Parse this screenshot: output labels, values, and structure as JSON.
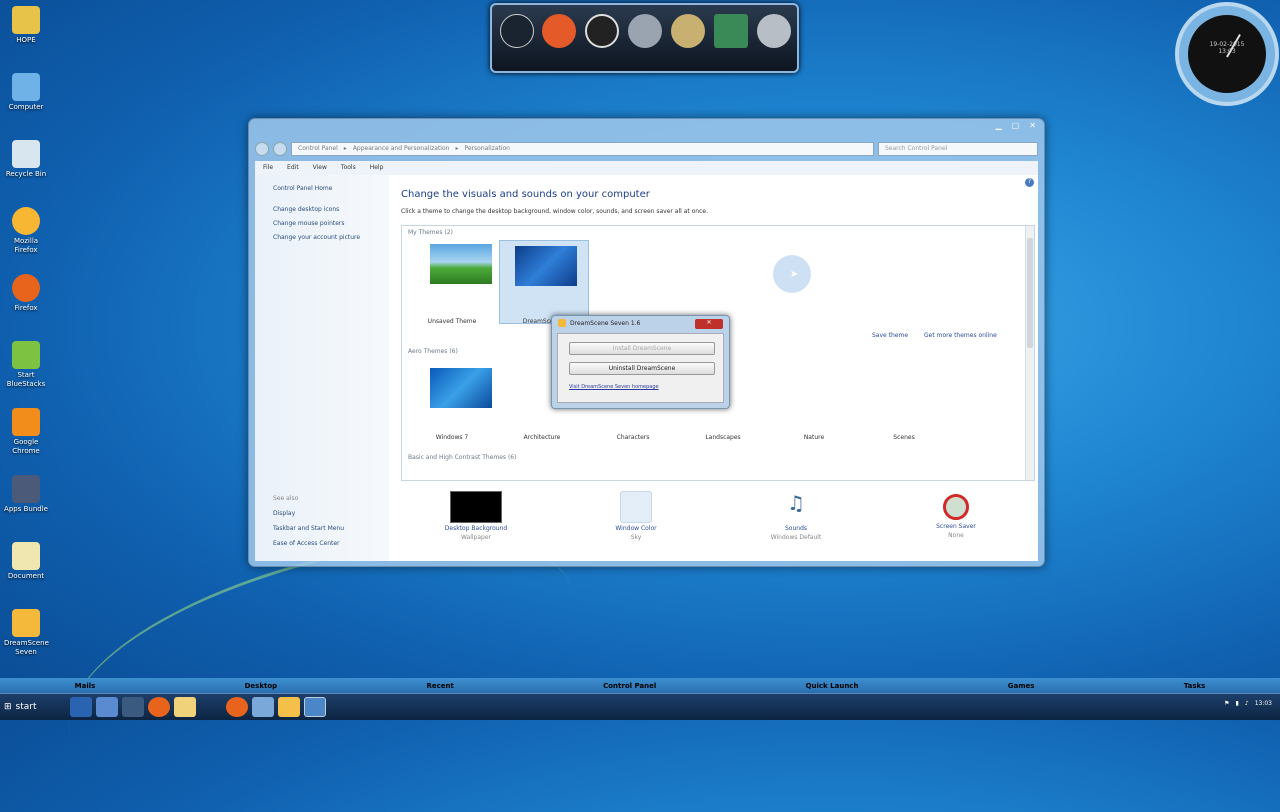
{
  "desktop": {
    "icons": [
      {
        "label": "HOPE",
        "color": "#e8c34a"
      },
      {
        "label": "Computer",
        "color": "#6fb2e8"
      },
      {
        "label": "Recycle Bin",
        "color": "#d8e6f0"
      },
      {
        "label": "Mozilla Firefox",
        "color": "#f7b733"
      },
      {
        "label": "Firefox",
        "color": "#e8641c"
      },
      {
        "label": "Start BlueStacks",
        "color": "#7ec242"
      },
      {
        "label": "Google Chrome",
        "color": "#f28d1c"
      },
      {
        "label": "Apps Bundle",
        "color": "#4a5a78"
      },
      {
        "label": "Document",
        "color": "#f0e6b0"
      },
      {
        "label": "DreamScene Seven",
        "color": "#f4b93a"
      }
    ]
  },
  "dock": {
    "items": [
      "nexus-icon",
      "windows-icon",
      "clock-icon",
      "recycle-icon",
      "disc-icon",
      "picture-icon",
      "settings-icon"
    ]
  },
  "clock": {
    "date": "19-02-2015",
    "time": "13:03"
  },
  "window": {
    "breadcrumb": [
      "Control Panel",
      "Appearance and Personalization",
      "Personalization"
    ],
    "search_placeholder": "Search Control Panel",
    "menu": [
      "File",
      "Edit",
      "View",
      "Tools",
      "Help"
    ],
    "sidebar": {
      "links": [
        "Control Panel Home",
        "Change desktop icons",
        "Change mouse pointers",
        "Change your account picture"
      ],
      "see_also_title": "See also",
      "see_also": [
        "Display",
        "Taskbar and Start Menu",
        "Ease of Access Center"
      ]
    },
    "title": "Change the visuals and sounds on your computer",
    "subtitle": "Click a theme to change the desktop background, window color, sounds, and screen saver all at once.",
    "my_themes_label": "My Themes (2)",
    "my_themes": [
      "Unsaved Theme",
      "DreamScene"
    ],
    "save_theme": "Save theme",
    "get_more": "Get more themes online",
    "aero_label": "Aero Themes (6)",
    "aero_themes": [
      "Windows 7",
      "Architecture",
      "Characters",
      "Landscapes",
      "Nature",
      "Scenes"
    ],
    "basic_label": "Basic and High Contrast Themes (6)",
    "bottom": [
      {
        "link": "Desktop Background",
        "value": "Wallpaper"
      },
      {
        "link": "Window Color",
        "value": "Sky"
      },
      {
        "link": "Sounds",
        "value": "Windows Default"
      },
      {
        "link": "Screen Saver",
        "value": "None"
      }
    ]
  },
  "dialog": {
    "title": "DreamScene Seven 1.6",
    "install": "Install DreamScene",
    "uninstall": "Uninstall DreamScene",
    "link": "Visit DreamScene Seven homepage"
  },
  "launchbar": [
    "Mails",
    "Desktop",
    "Recent",
    "Control Panel",
    "Quick Launch",
    "Games",
    "Tasks"
  ],
  "taskbar": {
    "start": "start",
    "time": "13:03"
  }
}
